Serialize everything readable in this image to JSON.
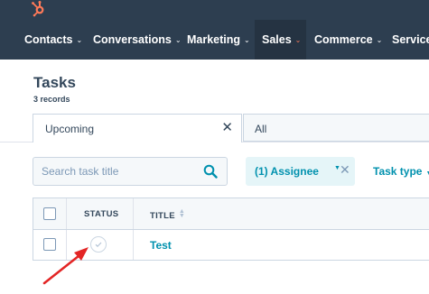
{
  "nav": {
    "items": [
      {
        "label": "Contacts",
        "chevron": "⌄"
      },
      {
        "label": "Conversations",
        "chevron": "⌄"
      },
      {
        "label": "Marketing",
        "chevron": "⌄"
      },
      {
        "label": "Sales",
        "chevron": "⌄",
        "active": true
      },
      {
        "label": "Commerce",
        "chevron": "⌄"
      },
      {
        "label": "Service",
        "chevron": "⌄"
      }
    ],
    "logo_icon": "hubspot-sprocket-icon",
    "logo_color": "#ff7a59",
    "bar_color": "#2d3e50"
  },
  "header": {
    "title": "Tasks",
    "record_count": "3 records"
  },
  "tabs": {
    "upcoming": {
      "label": "Upcoming",
      "close": "✕"
    },
    "all": {
      "label": "All"
    }
  },
  "filters": {
    "search_placeholder": "Search task title",
    "search_icon": "search-icon",
    "assignee_label": "(1) Assignee",
    "assignee_caret": "▼",
    "assignee_remove": "✕",
    "task_type_label": "Task type",
    "task_type_caret": "▼"
  },
  "table": {
    "columns": {
      "status": "STATUS",
      "title": "TITLE"
    },
    "rows": [
      {
        "title": "Test",
        "status_icon": "checkmark-circle-icon"
      }
    ]
  },
  "colors": {
    "accent": "#0091ae",
    "annotation": "#e32525"
  }
}
